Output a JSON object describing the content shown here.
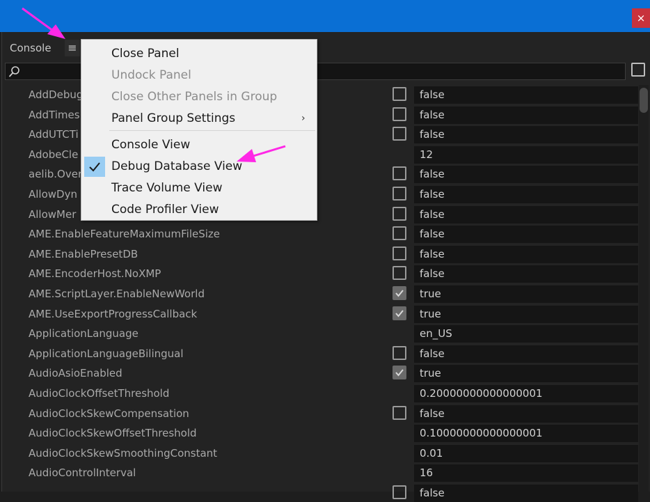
{
  "window": {
    "close_glyph": "×"
  },
  "panel": {
    "tab_label": "Console",
    "menu_glyph": "≡"
  },
  "menu": {
    "items": [
      {
        "label": "Close Panel",
        "enabled": true
      },
      {
        "label": "Undock Panel",
        "enabled": false
      },
      {
        "label": "Close Other Panels in Group",
        "enabled": false
      },
      {
        "label": "Panel Group Settings",
        "enabled": true,
        "submenu": true,
        "arrow": "›"
      },
      {
        "label": "Console View",
        "enabled": true
      },
      {
        "label": "Debug Database View",
        "enabled": true,
        "checked": true
      },
      {
        "label": "Trace Volume View",
        "enabled": true
      },
      {
        "label": "Code Profiler View",
        "enabled": true
      }
    ]
  },
  "rows": [
    {
      "name": "AddDebug",
      "checkbox": true,
      "checked": false,
      "value": "false"
    },
    {
      "name": "AddTimes",
      "checkbox": true,
      "checked": false,
      "value": "false"
    },
    {
      "name": "AddUTCTi",
      "checkbox": true,
      "checked": false,
      "value": "false"
    },
    {
      "name": "AdobeCle",
      "checkbox": false,
      "checked": false,
      "value": "12"
    },
    {
      "name": "aelib.Over",
      "checkbox": true,
      "checked": false,
      "value": "false"
    },
    {
      "name": "AllowDyn",
      "checkbox": true,
      "checked": false,
      "value": "false"
    },
    {
      "name": "AllowMer",
      "checkbox": true,
      "checked": false,
      "value": "false"
    },
    {
      "name": "AME.EnableFeatureMaximumFileSize",
      "checkbox": true,
      "checked": false,
      "value": "false"
    },
    {
      "name": "AME.EnablePresetDB",
      "checkbox": true,
      "checked": false,
      "value": "false"
    },
    {
      "name": "AME.EncoderHost.NoXMP",
      "checkbox": true,
      "checked": false,
      "value": "false"
    },
    {
      "name": "AME.ScriptLayer.EnableNewWorld",
      "checkbox": true,
      "checked": true,
      "value": "true"
    },
    {
      "name": "AME.UseExportProgressCallback",
      "checkbox": true,
      "checked": true,
      "value": "true"
    },
    {
      "name": "ApplicationLanguage",
      "checkbox": false,
      "checked": false,
      "value": "en_US"
    },
    {
      "name": "ApplicationLanguageBilingual",
      "checkbox": true,
      "checked": false,
      "value": "false"
    },
    {
      "name": "AudioAsioEnabled",
      "checkbox": true,
      "checked": true,
      "value": "true"
    },
    {
      "name": "AudioClockOffsetThreshold",
      "checkbox": false,
      "checked": false,
      "value": "0.20000000000000001"
    },
    {
      "name": "AudioClockSkewCompensation",
      "checkbox": true,
      "checked": false,
      "value": "false"
    },
    {
      "name": "AudioClockSkewOffsetThreshold",
      "checkbox": false,
      "checked": false,
      "value": "0.10000000000000001"
    },
    {
      "name": "AudioClockSkewSmoothingConstant",
      "checkbox": false,
      "checked": false,
      "value": "0.01"
    },
    {
      "name": "AudioControlInterval",
      "checkbox": false,
      "checked": false,
      "value": "16"
    },
    {
      "name": "",
      "checkbox": true,
      "checked": false,
      "value": "false"
    }
  ],
  "colors": {
    "titlebar": "#0a6fd4",
    "close_button": "#c8323c",
    "menu_check_highlight": "#99cdf3",
    "annotation_arrow": "#ff28e6"
  }
}
